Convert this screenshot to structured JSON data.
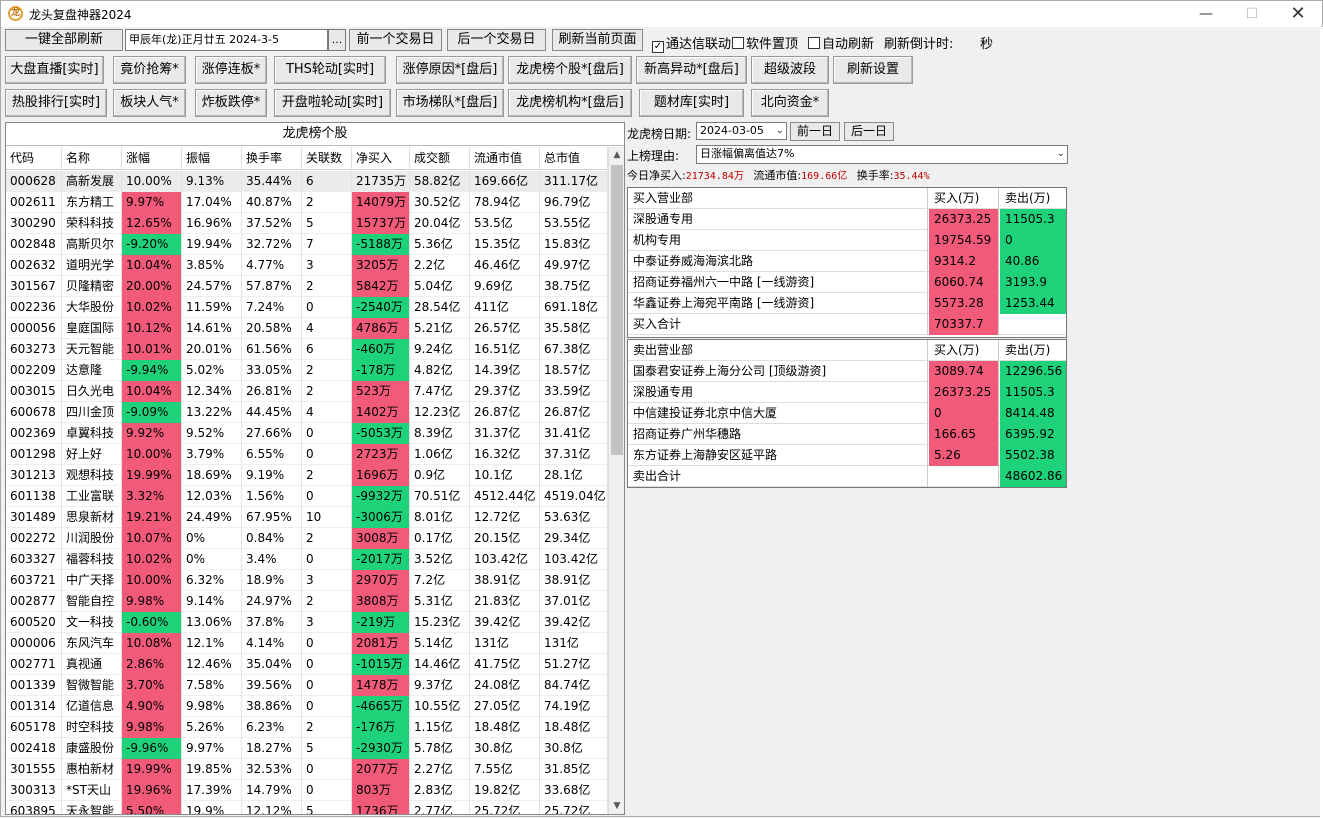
{
  "window": {
    "title": "龙头复盘神器2024",
    "icon_glyph": "龙"
  },
  "toolbar": {
    "refresh_all": "一键全部刷新",
    "lunar_date": "甲辰年(龙)正月廿五  2024-3-5",
    "dots": "...",
    "prev_day": "前一个交易日",
    "next_day": "后一个交易日",
    "refresh_page": "刷新当前页面",
    "tdx_link": "通达信联动",
    "tdx_link_checked": true,
    "pin_top": "软件置顶",
    "pin_top_checked": false,
    "auto_refresh": "自动刷新",
    "auto_refresh_checked": false,
    "countdown_label": "刷新倒计时:",
    "countdown_unit": "秒"
  },
  "nav_row1": [
    "大盘直播[实时]",
    "竟价抢筹*",
    "涨停连板*",
    "THS轮动[实时]",
    "涨停原因*[盘后]",
    "龙虎榜个股*[盘后]",
    "新高异动*[盘后]",
    "超级波段",
    "刷新设置"
  ],
  "nav_row2": [
    "热股排行[实时]",
    "板块人气*",
    "炸板跌停*",
    "开盘啦轮动[实时]",
    "市场梯队*[盘后]",
    "龙虎榜机构*[盘后]",
    "题材库[实时]",
    "北向资金*"
  ],
  "grid": {
    "title": "龙虎榜个股",
    "columns": [
      "代码",
      "名称",
      "涨幅",
      "振幅",
      "换手率",
      "关联数",
      "净买入",
      "成交额",
      "流通市值",
      "总市值"
    ],
    "rows": [
      [
        "000628",
        "高新发展",
        "10.00%",
        "9.13%",
        "35.44%",
        "6",
        "21735万",
        "58.82亿",
        "169.66亿",
        "311.17亿"
      ],
      [
        "002611",
        "东方精工",
        "9.97%",
        "17.04%",
        "40.87%",
        "2",
        "14079万",
        "30.52亿",
        "78.94亿",
        "96.79亿"
      ],
      [
        "300290",
        "荣科科技",
        "12.65%",
        "16.96%",
        "37.52%",
        "5",
        "15737万",
        "20.04亿",
        "53.5亿",
        "53.55亿"
      ],
      [
        "002848",
        "高斯贝尔",
        "-9.20%",
        "19.94%",
        "32.72%",
        "7",
        "-5188万",
        "5.36亿",
        "15.35亿",
        "15.83亿"
      ],
      [
        "002632",
        "道明光学",
        "10.04%",
        "3.85%",
        "4.77%",
        "3",
        "3205万",
        "2.2亿",
        "46.46亿",
        "49.97亿"
      ],
      [
        "301567",
        "贝隆精密",
        "20.00%",
        "24.57%",
        "57.87%",
        "2",
        "5842万",
        "5.04亿",
        "9.69亿",
        "38.75亿"
      ],
      [
        "002236",
        "大华股份",
        "10.02%",
        "11.59%",
        "7.24%",
        "0",
        "-2540万",
        "28.54亿",
        "411亿",
        "691.18亿"
      ],
      [
        "000056",
        "皇庭国际",
        "10.12%",
        "14.61%",
        "20.58%",
        "4",
        "4786万",
        "5.21亿",
        "26.57亿",
        "35.58亿"
      ],
      [
        "603273",
        "天元智能",
        "10.01%",
        "20.01%",
        "61.56%",
        "6",
        "-460万",
        "9.24亿",
        "16.51亿",
        "67.38亿"
      ],
      [
        "002209",
        "达意隆",
        "-9.94%",
        "5.02%",
        "33.05%",
        "2",
        "-178万",
        "4.82亿",
        "14.39亿",
        "18.57亿"
      ],
      [
        "003015",
        "日久光电",
        "10.04%",
        "12.34%",
        "26.81%",
        "2",
        "523万",
        "7.47亿",
        "29.37亿",
        "33.59亿"
      ],
      [
        "600678",
        "四川金顶",
        "-9.09%",
        "13.22%",
        "44.45%",
        "4",
        "1402万",
        "12.23亿",
        "26.87亿",
        "26.87亿"
      ],
      [
        "002369",
        "卓翼科技",
        "9.92%",
        "9.52%",
        "27.66%",
        "0",
        "-5053万",
        "8.39亿",
        "31.37亿",
        "31.41亿"
      ],
      [
        "001298",
        "好上好",
        "10.00%",
        "3.79%",
        "6.55%",
        "0",
        "2723万",
        "1.06亿",
        "16.32亿",
        "37.31亿"
      ],
      [
        "301213",
        "观想科技",
        "19.99%",
        "18.69%",
        "9.19%",
        "2",
        "1696万",
        "0.9亿",
        "10.1亿",
        "28.1亿"
      ],
      [
        "601138",
        "工业富联",
        "3.32%",
        "12.03%",
        "1.56%",
        "0",
        "-9932万",
        "70.51亿",
        "4512.44亿",
        "4519.04亿"
      ],
      [
        "301489",
        "思泉新材",
        "19.21%",
        "24.49%",
        "67.95%",
        "10",
        "-3006万",
        "8.01亿",
        "12.72亿",
        "53.63亿"
      ],
      [
        "002272",
        "川润股份",
        "10.07%",
        "0%",
        "0.84%",
        "2",
        "3008万",
        "0.17亿",
        "20.15亿",
        "29.34亿"
      ],
      [
        "603327",
        "福蓉科技",
        "10.02%",
        "0%",
        "3.4%",
        "0",
        "-2017万",
        "3.52亿",
        "103.42亿",
        "103.42亿"
      ],
      [
        "603721",
        "中广天择",
        "10.00%",
        "6.32%",
        "18.9%",
        "3",
        "2970万",
        "7.2亿",
        "38.91亿",
        "38.91亿"
      ],
      [
        "002877",
        "智能自控",
        "9.98%",
        "9.14%",
        "24.97%",
        "2",
        "3808万",
        "5.31亿",
        "21.83亿",
        "37.01亿"
      ],
      [
        "600520",
        "文一科技",
        "-0.60%",
        "13.06%",
        "37.8%",
        "3",
        "-219万",
        "15.23亿",
        "39.42亿",
        "39.42亿"
      ],
      [
        "000006",
        "东风汽车",
        "10.08%",
        "12.1%",
        "4.14%",
        "0",
        "2081万",
        "5.14亿",
        "131亿",
        "131亿"
      ],
      [
        "002771",
        "真视通",
        "2.86%",
        "12.46%",
        "35.04%",
        "0",
        "-1015万",
        "14.46亿",
        "41.75亿",
        "51.27亿"
      ],
      [
        "001339",
        "智微智能",
        "3.70%",
        "7.58%",
        "39.56%",
        "0",
        "1478万",
        "9.37亿",
        "24.08亿",
        "84.74亿"
      ],
      [
        "001314",
        "亿道信息",
        "4.90%",
        "9.98%",
        "38.86%",
        "0",
        "-4665万",
        "10.55亿",
        "27.05亿",
        "74.19亿"
      ],
      [
        "605178",
        "时空科技",
        "9.98%",
        "5.26%",
        "6.23%",
        "2",
        "-176万",
        "1.15亿",
        "18.48亿",
        "18.48亿"
      ],
      [
        "002418",
        "康盛股份",
        "-9.96%",
        "9.97%",
        "18.27%",
        "5",
        "-2930万",
        "5.78亿",
        "30.8亿",
        "30.8亿"
      ],
      [
        "301555",
        "惠柏新材",
        "19.99%",
        "19.85%",
        "32.53%",
        "0",
        "2077万",
        "2.27亿",
        "7.55亿",
        "31.85亿"
      ],
      [
        "300313",
        "*ST天山",
        "19.96%",
        "17.39%",
        "14.79%",
        "0",
        "803万",
        "2.83亿",
        "19.82亿",
        "33.68亿"
      ],
      [
        "603895",
        "天永智能",
        "5.50%",
        "19.9%",
        "12.12%",
        "5",
        "1736万",
        "2.77亿",
        "25.72亿",
        "25.72亿"
      ]
    ]
  },
  "detail": {
    "date_label": "龙虎榜日期:",
    "date_value": "2024-03-05",
    "prev": "前一日",
    "next": "后一日",
    "reason_label": "上榜理由:",
    "reason_value": "日涨幅偏离值达7%",
    "net_buy_label": "今日净买入:",
    "net_buy_value": "21734.84万",
    "float_label": "流通市值:",
    "float_value": "169.66亿",
    "turnover_label": "换手率:",
    "turnover_value": "35.44%",
    "buy_table": {
      "headers": [
        "买入营业部",
        "买入(万)",
        "卖出(万)"
      ],
      "rows": [
        [
          "深股通专用",
          "26373.25",
          "11505.3"
        ],
        [
          "机构专用",
          "19754.59",
          "0"
        ],
        [
          "中泰证券威海海滨北路",
          "9314.2",
          "40.86"
        ],
        [
          "招商证券福州六一中路 [一线游资]",
          "6060.74",
          "3193.9"
        ],
        [
          "华鑫证券上海宛平南路 [一线游资]",
          "5573.28",
          "1253.44"
        ],
        [
          "买入合计",
          "70337.7",
          ""
        ]
      ]
    },
    "sell_table": {
      "headers": [
        "卖出营业部",
        "买入(万)",
        "卖出(万)"
      ],
      "rows": [
        [
          "国泰君安证券上海分公司 [顶级游资]",
          "3089.74",
          "12296.56"
        ],
        [
          "深股通专用",
          "26373.25",
          "11505.3"
        ],
        [
          "中信建投证券北京中信大厦",
          "0",
          "8414.48"
        ],
        [
          "招商证券广州华穗路",
          "166.65",
          "6395.92"
        ],
        [
          "东方证券上海静安区延平路",
          "5.26",
          "5502.38"
        ],
        [
          "卖出合计",
          "",
          "48602.86"
        ]
      ]
    }
  },
  "colors": {
    "up": "#f25a7a",
    "down": "#1ed27a",
    "value_text": "#c00000"
  }
}
